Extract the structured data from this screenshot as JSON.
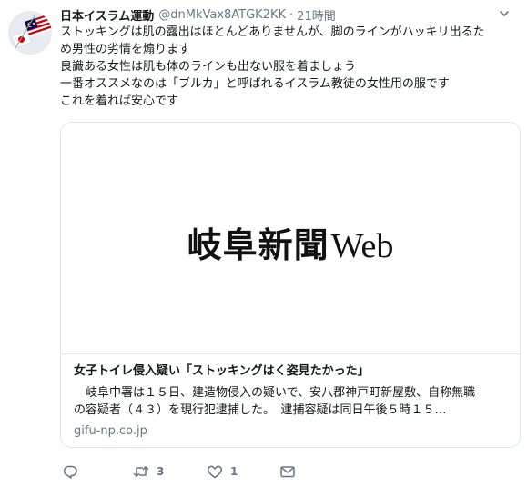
{
  "tweet": {
    "display_name": "日本イスラム運動",
    "handle": "@dnMkVax8ATGK2KK",
    "separator": "·",
    "time": "21時間",
    "lines": [
      "ストッキングは肌の露出はほとんどありませんが、脚のラインがハッキリ出るた",
      "め男性の劣情を煽ります",
      "良識ある女性は肌も体のラインも出ない服を着ましょう",
      "一番オススメなのは「ブルカ」と呼ばれるイスラム教徒の女性用の服です",
      "これを着れば安心です"
    ]
  },
  "card": {
    "logo_kanji": "岐阜新聞",
    "logo_web": "Web",
    "title": "女子トイレ侵入疑い「ストッキングはく姿見たかった」",
    "description_lines": [
      "　岐阜中署は１５日、建造物侵入の疑いで、安八郡神戸町新屋敷、自称無職",
      "の容疑者（４３）を現行犯逮捕した。　逮捕容疑は同日午後５時１５…"
    ],
    "domain": "gifu-np.co.jp"
  },
  "actions": {
    "retweet_count": "3",
    "like_count": "1"
  },
  "icons": {
    "reply": "reply-icon",
    "retweet": "retweet-icon",
    "like": "heart-icon",
    "dm": "envelope-icon",
    "caret": "chevron-down-icon"
  },
  "colors": {
    "text": "#14171a",
    "muted": "#657786",
    "border": "#e1e8ed"
  }
}
